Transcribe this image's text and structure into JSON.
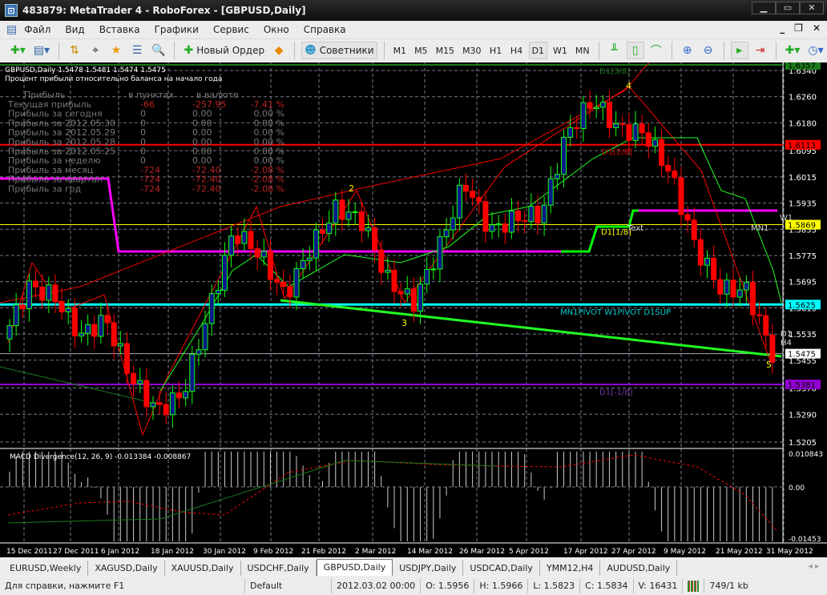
{
  "window": {
    "title": "483879: MetaTrader 4 - RoboForex - [GBPUSD,Daily]",
    "app_icon": "metatrader-icon"
  },
  "menu": [
    "Файл",
    "Вид",
    "Вставка",
    "Графики",
    "Сервис",
    "Окно",
    "Справка"
  ],
  "toolbar": {
    "new_order": "Новый Ордер",
    "experts": "Советники",
    "timeframes": [
      "M1",
      "M5",
      "M15",
      "M30",
      "H1",
      "H4",
      "D1",
      "W1",
      "MN"
    ],
    "active_timeframe": "D1"
  },
  "chart": {
    "header": "GBPUSD,Daily  1.5478 1.5481 1.5474 1.5475",
    "subheader": "Процент прибыли относительно баланса на начало года",
    "profit_table": {
      "headers": [
        "Прибыль",
        "в пунктах",
        "в валюте"
      ],
      "rows": [
        {
          "label": "Текущая прибыль",
          "points": "-66",
          "money": "-257.95",
          "pct": "-7.41 %",
          "neg": true
        },
        {
          "label": "Прибыль за сегодня",
          "points": "0",
          "money": "0.00",
          "pct": "0.00 %",
          "neg": false
        },
        {
          "label": "Прибыль за 2012.05.30",
          "points": "0",
          "money": "0.00",
          "pct": "0.00 %",
          "neg": false
        },
        {
          "label": "Прибыль за 2012.05.29",
          "points": "0",
          "money": "0.00",
          "pct": "0.00 %",
          "neg": false
        },
        {
          "label": "Прибыль за 2012.05.28",
          "points": "0",
          "money": "0.00",
          "pct": "0.00 %",
          "neg": false
        },
        {
          "label": "Прибыль за 2012.05.25",
          "points": "0",
          "money": "0.00",
          "pct": "0.00 %",
          "neg": false
        },
        {
          "label": "Прибыль за неделю",
          "points": "0",
          "money": "0.00",
          "pct": "0.00 %",
          "neg": false
        },
        {
          "label": "Прибыль за месяц",
          "points": "-724",
          "money": "-72.40",
          "pct": "-2.08 %",
          "neg": true
        },
        {
          "label": "Прибыль за квартал",
          "points": "-724",
          "money": "-72.40",
          "pct": "-2.08 %",
          "neg": true
        },
        {
          "label": "Прибыль за год",
          "points": "-724",
          "money": "-72.40",
          "pct": "-2.08 %",
          "neg": true
        }
      ]
    },
    "price_ticks": [
      "1.6340",
      "1.6260",
      "1.6180",
      "1.6095",
      "1.6015",
      "1.5935",
      "1.5855",
      "1.5775",
      "1.5695",
      "1.5615",
      "1.5535",
      "1.5455",
      "1.5370",
      "1.5290",
      "1.5205"
    ],
    "price_labels": [
      {
        "value": "1.6357",
        "bg": "#1a7a1a",
        "fg": "#000"
      },
      {
        "value": "1.6113",
        "bg": "#ff0000",
        "fg": "#000"
      },
      {
        "value": "1.5869",
        "bg": "#ffff00",
        "fg": "#000"
      },
      {
        "value": "1.5625",
        "bg": "#00ffff",
        "fg": "#000"
      },
      {
        "value": "1.5475",
        "bg": "#ffffff",
        "fg": "#000"
      },
      {
        "value": "1.5381",
        "bg": "#9400d3",
        "fg": "#000"
      }
    ],
    "annotations": {
      "d1_38": "D1[3/8]",
      "d1_28": "D1[2/8]",
      "d1_18": "D1[1/8]",
      "text": "Text",
      "mn1": "MN1",
      "w1": "W1",
      "pivot": "MN1PIVOT W1PIVOT D1SUP",
      "d1": "D1",
      "h4": "H4",
      "d1_m18": "D1[-1/8]",
      "w2": "2",
      "w3": "3",
      "w4": "4",
      "w5": "5"
    },
    "date_ticks": [
      "15 Dec 2011",
      "27 Dec 2011",
      "6 Jan 2012",
      "18 Jan 2012",
      "30 Jan 2012",
      "9 Feb 2012",
      "21 Feb 2012",
      "2 Mar 2012",
      "14 Mar 2012",
      "26 Mar 2012",
      "5 Apr 2012",
      "17 Apr 2012",
      "27 Apr 2012",
      "9 May 2012",
      "21 May 2012",
      "31 May 2012"
    ],
    "price_path": [
      1.552,
      1.568,
      1.565,
      1.553,
      1.558,
      1.54,
      1.53,
      1.535,
      1.56,
      1.585,
      1.578,
      1.565,
      1.58,
      1.592,
      1.588,
      1.57,
      1.563,
      1.58,
      1.6,
      1.585,
      1.589,
      1.59,
      1.615,
      1.625,
      1.616,
      1.615,
      1.603,
      1.58,
      1.567,
      1.567,
      1.5475
    ],
    "macd": {
      "title": "MACD Divergence(12, 26, 9) -0.013384 -0.008867",
      "ticks": [
        "0.010843",
        "0.00",
        "-0.01453"
      ]
    }
  },
  "tabs": [
    "EURUSD,Weekly",
    "XAGUSD,Daily",
    "XAUUSD,Daily",
    "USDCHF,Daily",
    "GBPUSD,Daily",
    "USDJPY,Daily",
    "USDCAD,Daily",
    "YMM12,H4",
    "AUDUSD,Daily"
  ],
  "active_tab": "GBPUSD,Daily",
  "status": {
    "help": "Для справки, нажмите F1",
    "profile": "Default",
    "time": "2012.03.02 00:00",
    "open": "O: 1.5956",
    "high": "H: 1.5966",
    "low": "L: 1.5823",
    "close": "C: 1.5834",
    "volume": "V: 16431",
    "traffic": "749/1 kb"
  }
}
